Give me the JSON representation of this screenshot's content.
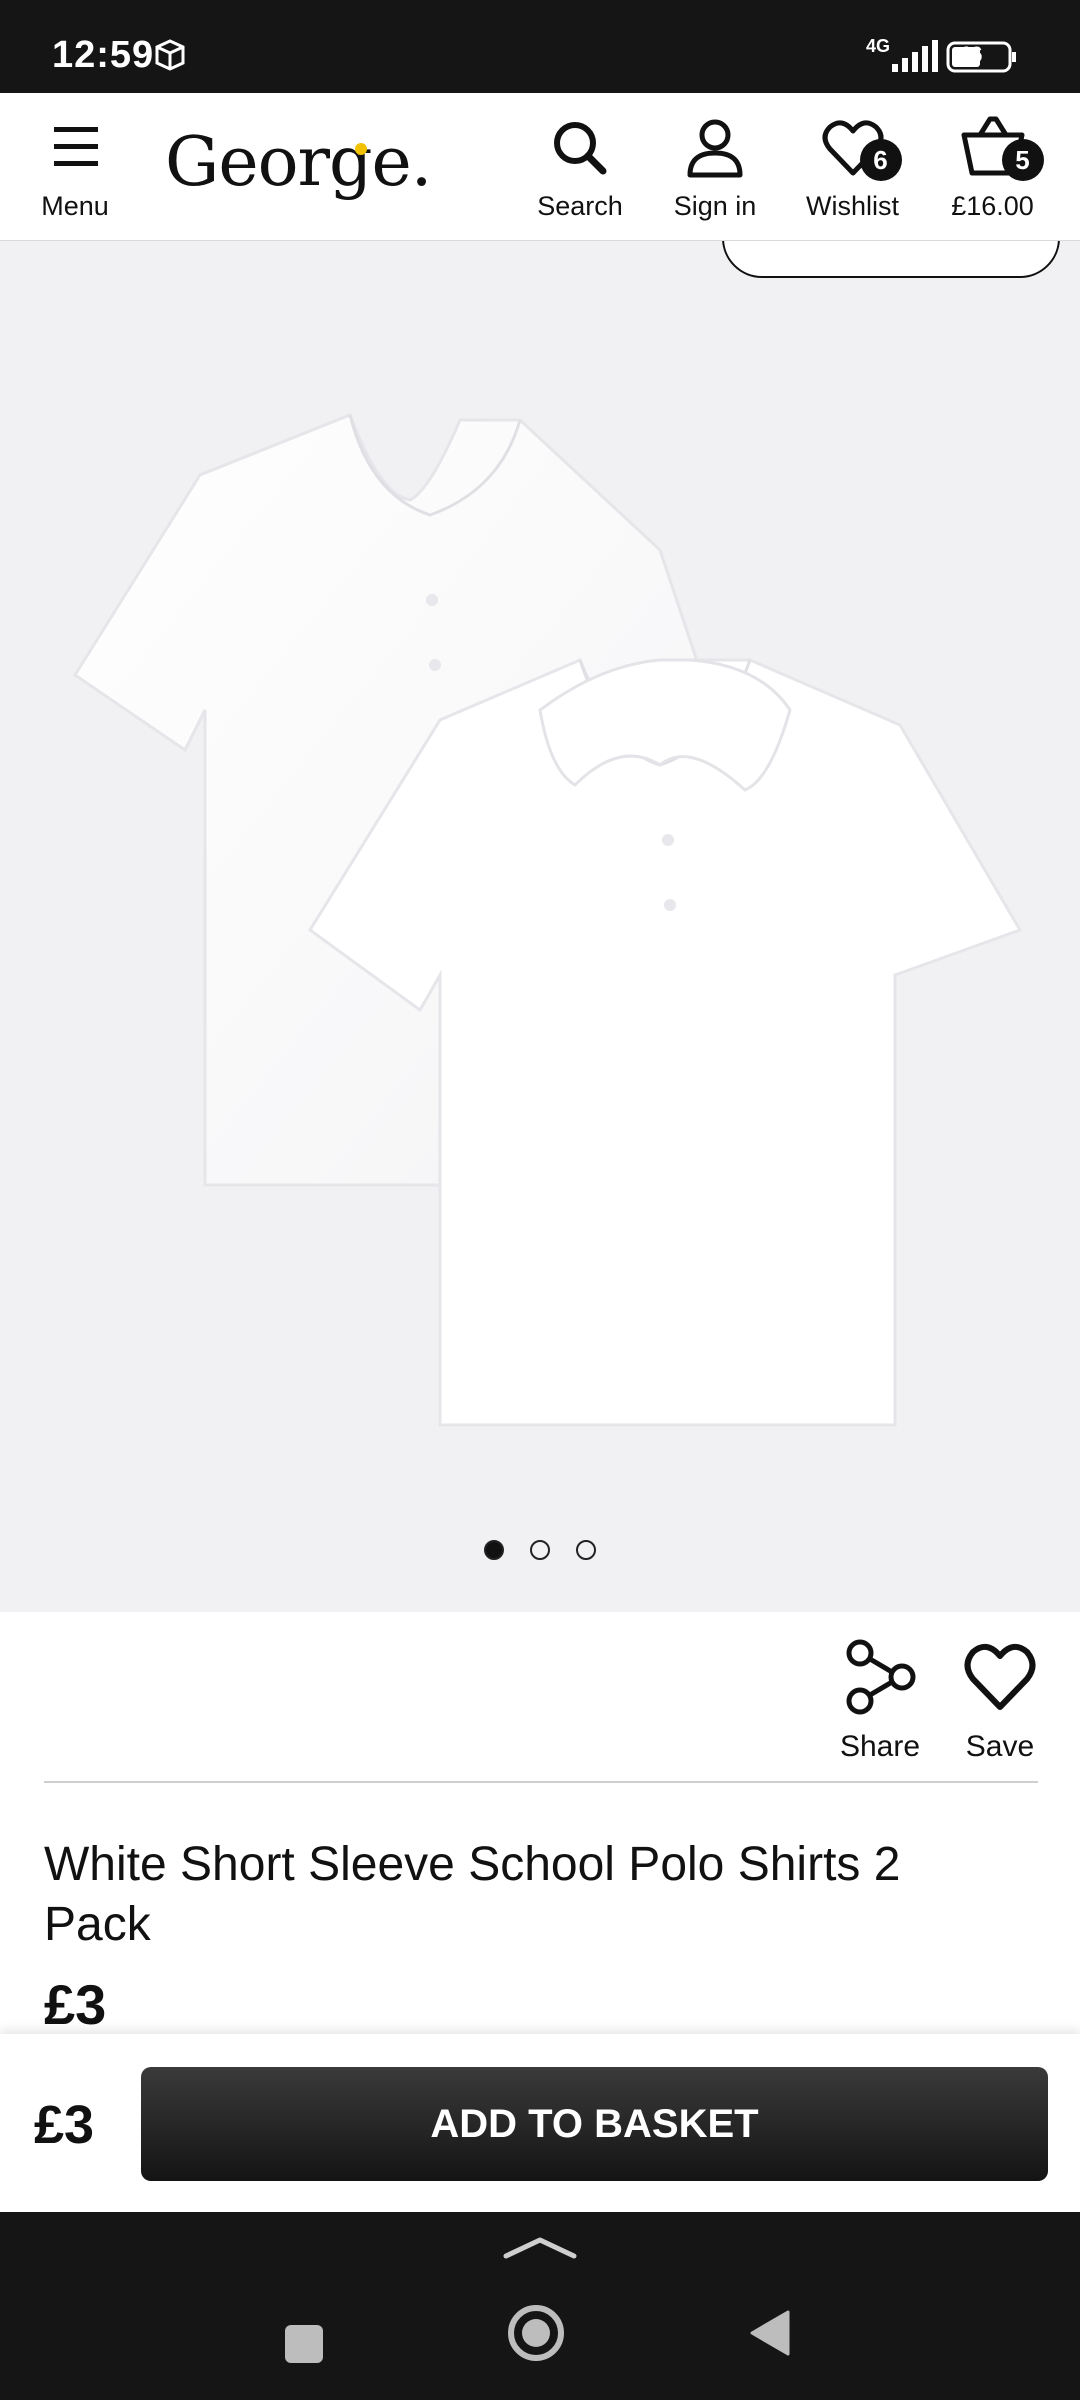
{
  "status_bar": {
    "time": "12:59",
    "network": "4G",
    "battery": "46"
  },
  "header": {
    "menu_label": "Menu",
    "logo": "George.",
    "search_label": "Search",
    "signin_label": "Sign in",
    "wishlist_label": "Wishlist",
    "wishlist_count": "6",
    "basket_total": "£16.00",
    "basket_count": "5"
  },
  "gallery": {
    "slide_count": 3,
    "active_slide": 1
  },
  "actions": {
    "share_label": "Share",
    "save_label": "Save"
  },
  "product": {
    "title": "White Short Sleeve School Polo Shirts 2 Pack",
    "price": "£3"
  },
  "basket_bar": {
    "price": "£3",
    "button_label": "ADD TO BASKET"
  },
  "colors": {
    "accent": "#111111",
    "logo_dot": "#f2c200",
    "gallery_bg": "#f1f1f3"
  }
}
